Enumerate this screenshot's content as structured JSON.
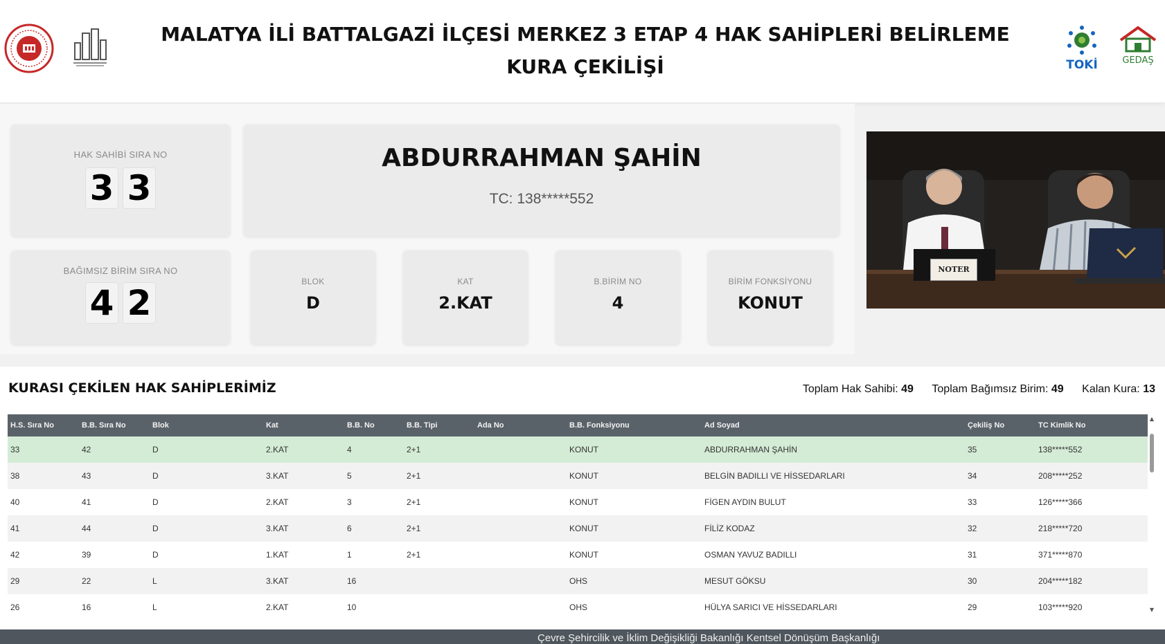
{
  "header": {
    "title": "MALATYA İLİ BATTALGAZİ İLÇESİ MERKEZ 3 ETAP 4 HAK SAHİPLERİ BELİRLEME KURA ÇEKİLİŞİ",
    "logos": {
      "left_seal": "ministry-seal-icon",
      "left_building": "urban-transformation-icon",
      "right_toki": "TOKİ",
      "right_gedas": "GEDAŞ"
    }
  },
  "current": {
    "hak_sahibi_label": "HAK SAHİBİ SIRA NO",
    "hak_sahibi_digits": [
      "3",
      "3"
    ],
    "bagimsiz_label": "BAĞIMSIZ BİRİM SIRA NO",
    "bagimsiz_digits": [
      "4",
      "2"
    ],
    "name": "ABDURRAHMAN ŞAHİN",
    "tc": "TC: 138*****552",
    "blok_label": "BLOK",
    "blok": "D",
    "kat_label": "KAT",
    "kat": "2.KAT",
    "birim_no_label": "B.BİRİM NO",
    "birim_no": "4",
    "fonksiyon_label": "BİRİM FONKSİYONU",
    "fonksiyon": "KONUT"
  },
  "video": {
    "placard": "NOTER"
  },
  "list": {
    "title": "KURASI ÇEKİLEN HAK SAHİPLERİMİZ",
    "stats": {
      "toplam_hak_sahibi_label": "Toplam Hak Sahibi:",
      "toplam_hak_sahibi": "49",
      "toplam_bagimsiz_label": "Toplam Bağımsız Birim:",
      "toplam_bagimsiz": "49",
      "kalan_label": "Kalan Kura:",
      "kalan": "13"
    },
    "columns": [
      "H.S. Sıra No",
      "B.B. Sıra No",
      "Blok",
      "Kat",
      "B.B. No",
      "B.B. Tipi",
      "Ada No",
      "B.B. Fonksiyonu",
      "Ad Soyad",
      "Çekiliş No",
      "TC Kimlik No"
    ],
    "rows": [
      [
        "33",
        "42",
        "D",
        "2.KAT",
        "4",
        "2+1",
        "",
        "KONUT",
        "ABDURRAHMAN ŞAHİN",
        "35",
        "138*****552"
      ],
      [
        "38",
        "43",
        "D",
        "3.KAT",
        "5",
        "2+1",
        "",
        "KONUT",
        "BELGİN BADILLI VE HİSSEDARLARI",
        "34",
        "208*****252"
      ],
      [
        "40",
        "41",
        "D",
        "2.KAT",
        "3",
        "2+1",
        "",
        "KONUT",
        "FİGEN AYDIN BULUT",
        "33",
        "126*****366"
      ],
      [
        "41",
        "44",
        "D",
        "3.KAT",
        "6",
        "2+1",
        "",
        "KONUT",
        "FİLİZ KODAZ",
        "32",
        "218*****720"
      ],
      [
        "42",
        "39",
        "D",
        "1.KAT",
        "1",
        "2+1",
        "",
        "KONUT",
        "OSMAN YAVUZ BADILLI",
        "31",
        "371*****870"
      ],
      [
        "29",
        "22",
        "L",
        "3.KAT",
        "16",
        "",
        "",
        "OHS",
        "MESUT GÖKSU",
        "30",
        "204*****182"
      ],
      [
        "26",
        "16",
        "L",
        "2.KAT",
        "10",
        "",
        "",
        "OHS",
        "HÜLYA SARICI VE HİSSEDARLARI",
        "29",
        "103*****920"
      ]
    ]
  },
  "footer": {
    "text": "Çevre Şehircilik ve İklim Değişikliği Bakanlığı Kentsel Dönüşüm Başkanlığı"
  }
}
